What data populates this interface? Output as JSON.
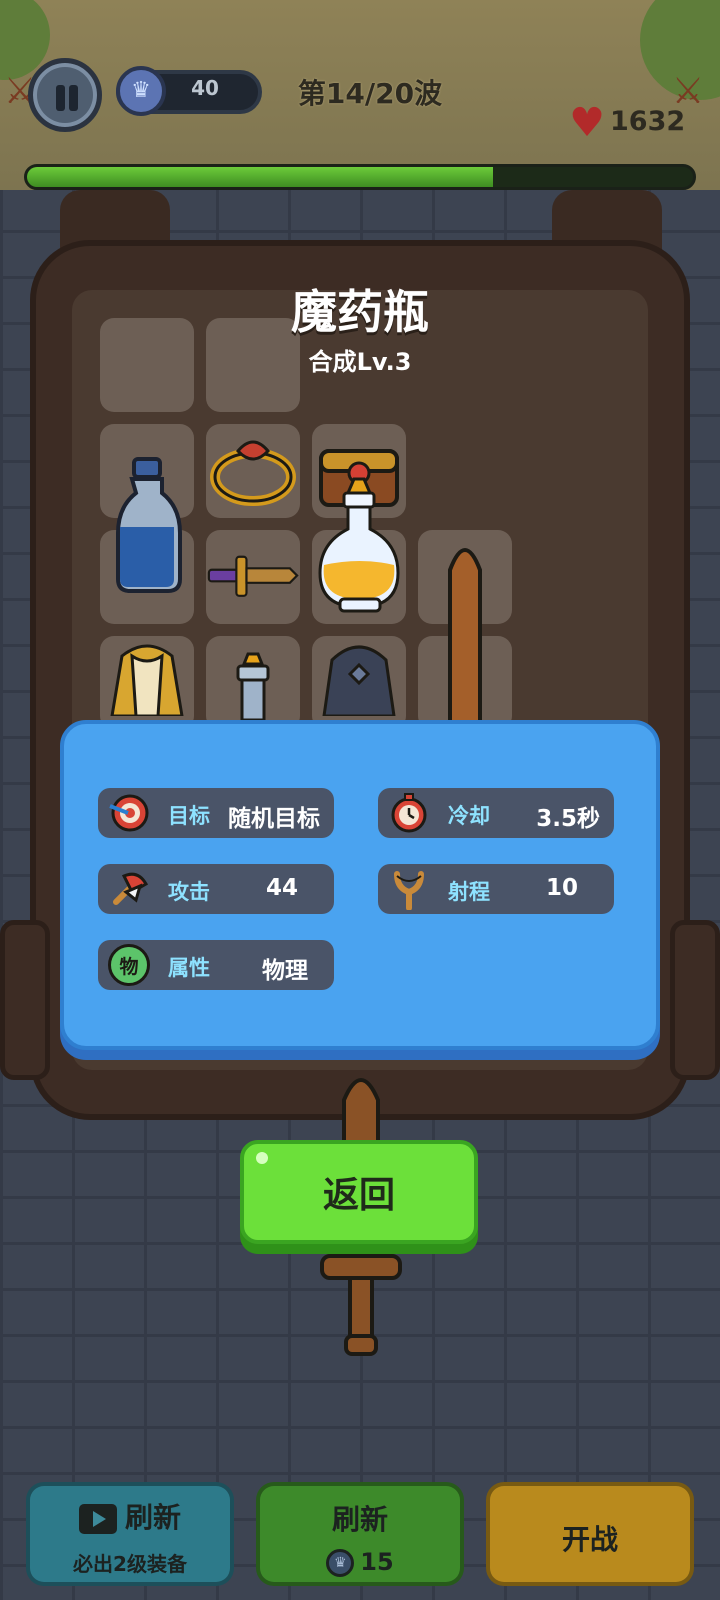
{
  "hud": {
    "gem_count": "40",
    "wave": "第14/20波",
    "hp": "1632",
    "wave_progress": 0.7
  },
  "item": {
    "name": "魔药瓶",
    "level": "合成Lv.3"
  },
  "stats": {
    "target_label": "目标",
    "target_value": "随机目标",
    "cooldown_label": "冷却",
    "cooldown_value": "3.5秒",
    "attack_label": "攻击",
    "attack_value": "44",
    "range_label": "射程",
    "range_value": "10",
    "attribute_icon": "物",
    "attribute_label": "属性",
    "attribute_value": "物理"
  },
  "back_button": "返回",
  "bottom": {
    "refresh_ad_label": "刷新",
    "refresh_ad_sub": "必出2级装备",
    "refresh_gem_label": "刷新",
    "refresh_gem_cost": "15",
    "start_label": "开战"
  },
  "colors": {
    "panel_blue": "#4aa3f0",
    "stat_label": "#8ee2ff",
    "back_green": "#6ce03a",
    "hp_red": "#b22a2a"
  }
}
